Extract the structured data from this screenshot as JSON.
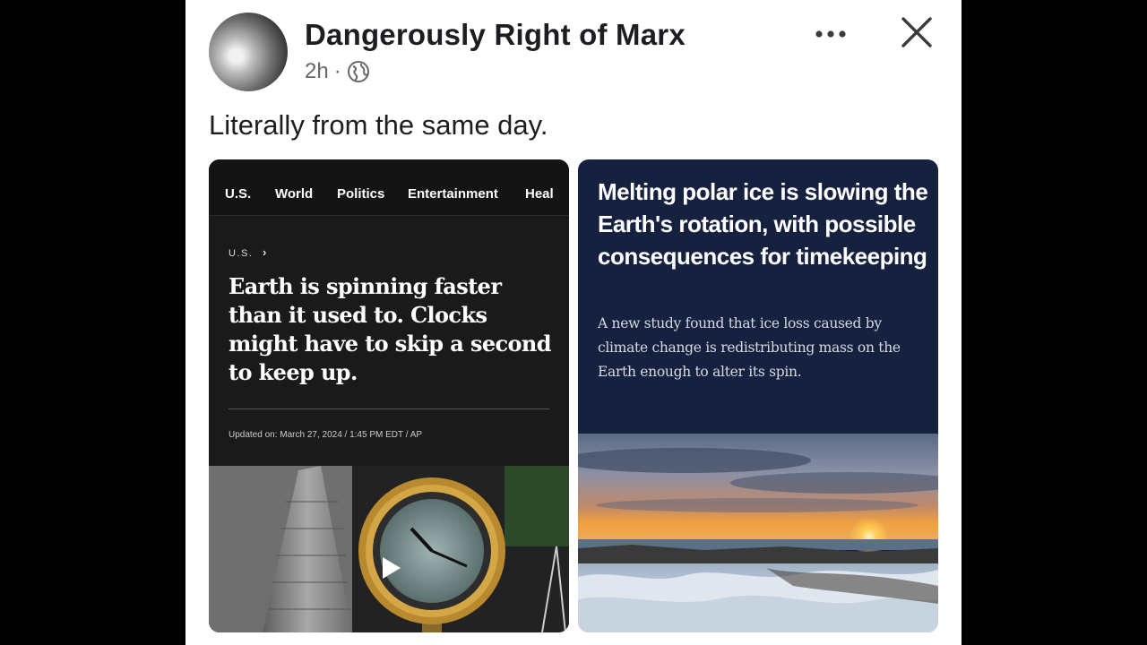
{
  "post": {
    "author": "Dangerously Right of Marx",
    "time": "2h",
    "separator": "·",
    "caption": "Literally from the same day."
  },
  "icons": {
    "privacy": "globe-icon",
    "more": "more-horizontal-icon",
    "close": "close-icon",
    "play": "play-icon"
  },
  "left_card": {
    "nav": [
      "U.S.",
      "World",
      "Politics",
      "Entertainment",
      "Heal"
    ],
    "breadcrumb": "U.S.",
    "breadcrumb_arrow": "›",
    "headline": "Earth is spinning faster than it used to. Clocks might have to skip a second to keep up.",
    "updated": "Updated on: March 27, 2024 / 1:45 PM EDT / AP"
  },
  "right_card": {
    "headline": "Melting polar ice is slowing the Earth's rotation, with possible consequences for timekeeping",
    "subhead": "A new study found that ice loss caused by climate change is redistributing mass on the Earth enough to alter its spin."
  },
  "colors": {
    "page_bg": "#000000",
    "post_bg": "#ffffff",
    "left_card_bg": "#1a1a1a",
    "right_card_bg": "#15213f"
  }
}
